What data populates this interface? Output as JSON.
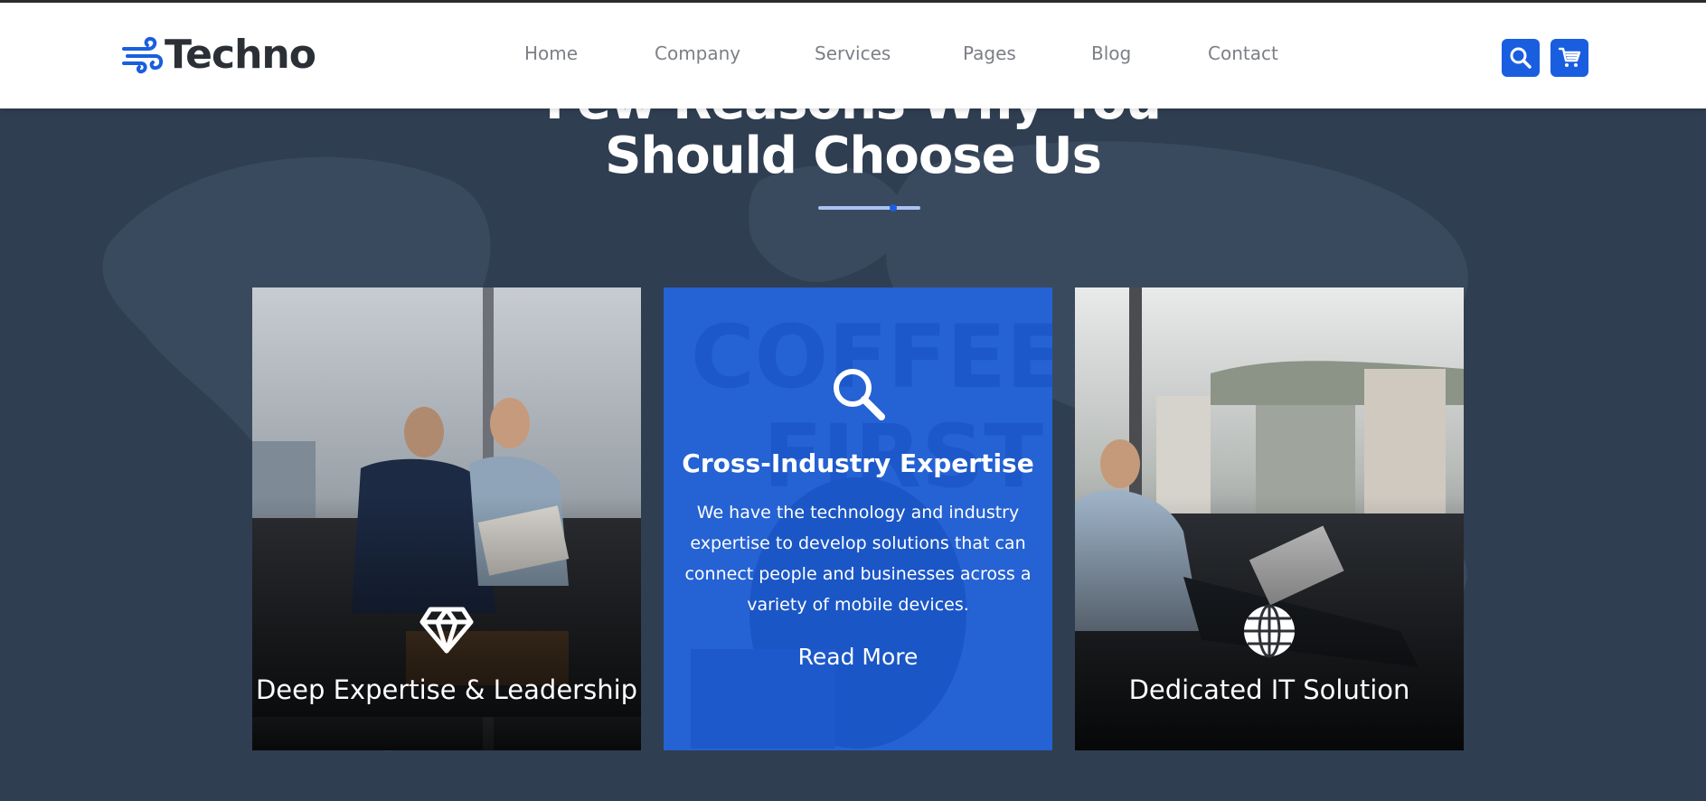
{
  "header": {
    "logo_text": "Techno",
    "nav": [
      {
        "label": "Home"
      },
      {
        "label": "Company"
      },
      {
        "label": "Services"
      },
      {
        "label": "Pages"
      },
      {
        "label": "Blog"
      },
      {
        "label": "Contact"
      }
    ],
    "search_icon": "search-icon",
    "cart_icon": "cart-icon"
  },
  "section": {
    "heading_line1": "Few Reasons Why You",
    "heading_line2": "Should Choose Us"
  },
  "cards": [
    {
      "icon": "diamond-icon",
      "title": "Deep Expertise & Leadership"
    },
    {
      "icon": "search-icon",
      "title": "Cross-Industry Expertise",
      "description": "We have the technology and industry expertise to develop solutions that can connect people and businesses across a variety of mobile devices.",
      "link": "Read More"
    },
    {
      "icon": "globe-icon",
      "title": "Dedicated IT Solution"
    }
  ],
  "colors": {
    "accent": "#1a5ee0",
    "section_bg": "#2f3e51",
    "header_bg": "#ffffff",
    "nav_text": "#7c7f86",
    "divider_light": "#a9c3f2"
  }
}
